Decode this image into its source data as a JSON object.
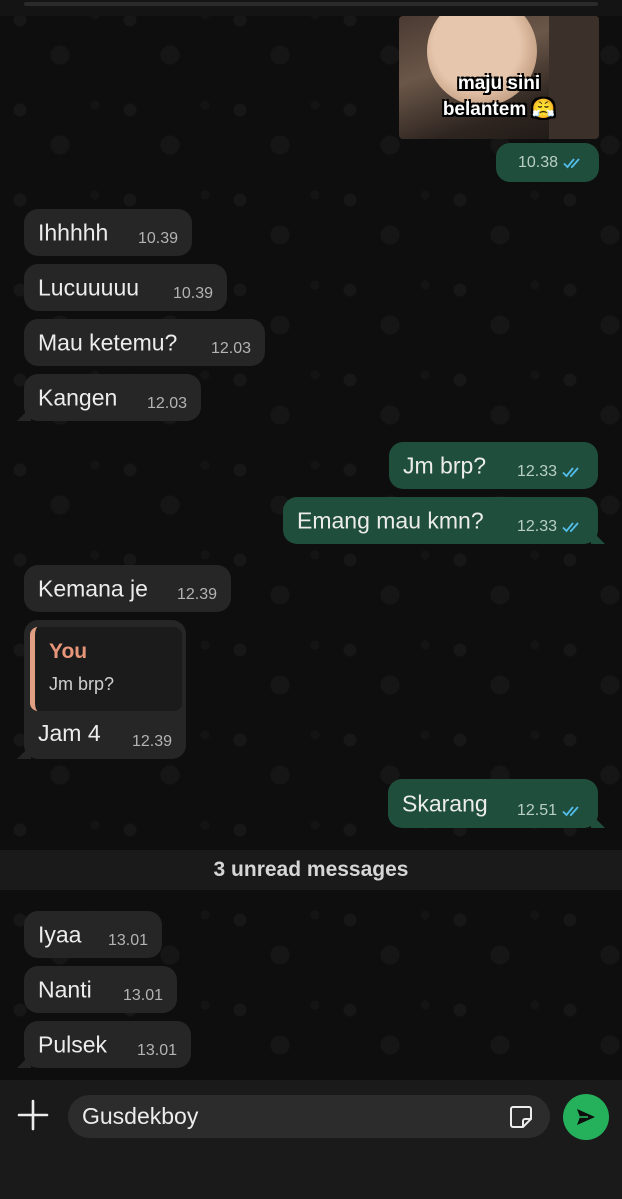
{
  "media_message": {
    "caption_line1": "maju sini",
    "caption_line2": "belantem 😤",
    "time": "10.38"
  },
  "messages_before_unread": [
    {
      "direction": "in",
      "text": "Ihhhhh",
      "time": "10.39"
    },
    {
      "direction": "in",
      "text": "Lucuuuuu",
      "time": "10.39"
    },
    {
      "direction": "in",
      "text": "Mau ketemu?",
      "time": "12.03"
    },
    {
      "direction": "in",
      "text": "Kangen",
      "time": "12.03"
    },
    {
      "direction": "out",
      "text": "Jm brp?",
      "time": "12.33",
      "status": "read"
    },
    {
      "direction": "out",
      "text": "Emang mau kmn?",
      "time": "12.33",
      "status": "read"
    },
    {
      "direction": "in",
      "text": "Kemana je",
      "time": "12.39"
    },
    {
      "direction": "in",
      "text": "Jam 4",
      "time": "12.39",
      "reply_to": {
        "author": "You",
        "text": "Jm brp?"
      }
    },
    {
      "direction": "out",
      "text": "Skarang",
      "time": "12.51",
      "status": "read"
    }
  ],
  "unread_banner": "3 unread messages",
  "messages_after_unread": [
    {
      "direction": "in",
      "text": "Iyaa",
      "time": "13.01"
    },
    {
      "direction": "in",
      "text": "Nanti",
      "time": "13.01"
    },
    {
      "direction": "in",
      "text": "Pulsek",
      "time": "13.01"
    }
  ],
  "composer": {
    "input_value": "Gusdekboy",
    "icons": [
      "plus-icon",
      "sticker-icon",
      "send-icon"
    ]
  },
  "colors": {
    "incoming_bubble": "#262626",
    "outgoing_bubble": "#1f4e3c",
    "read_ticks": "#53bdeb",
    "reply_accent": "#e8967a",
    "send_button": "#25b15b"
  }
}
